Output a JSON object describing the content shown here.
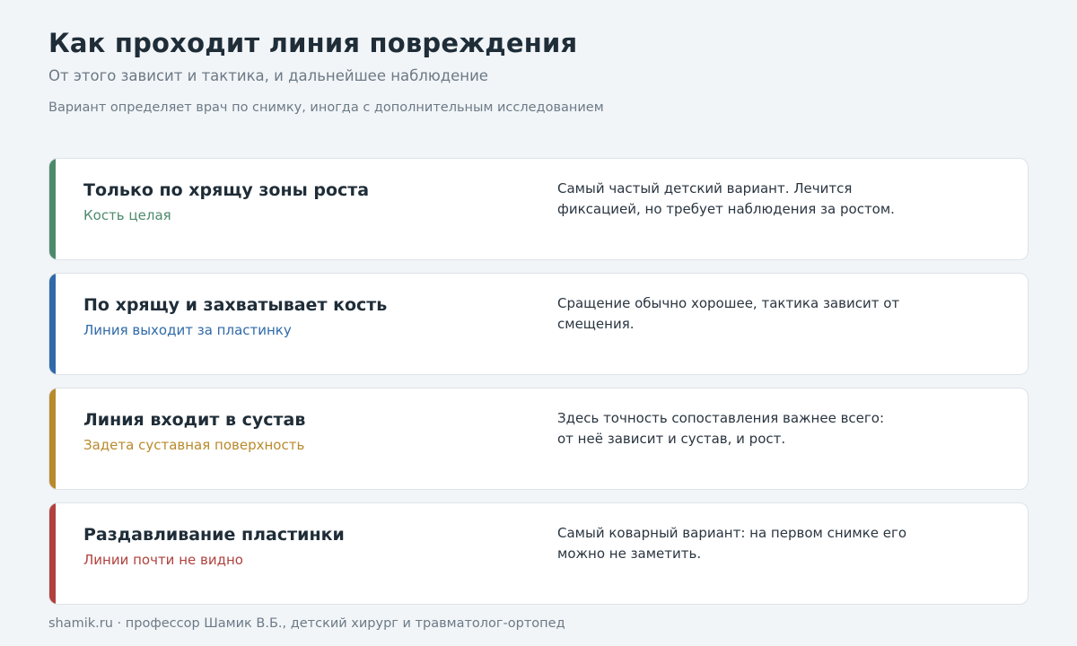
{
  "header": {
    "title": "Как проходит линия повреждения",
    "subtitle": "От этого зависит и тактика, и дальнейшее наблюдение",
    "note": "Вариант определяет врач по снимку, иногда с дополнительным исследованием"
  },
  "cards": [
    {
      "title": "Только по хрящу зоны роста",
      "tag": "Кость целая",
      "description": "Самый частый детский вариант. Лечится\nфиксацией, но требует наблюдения за ростом.",
      "accent": "#4d8a6c"
    },
    {
      "title": "По хрящу и захватывает кость",
      "tag": "Линия выходит за пластинку",
      "description": "Сращение обычно хорошее, тактика зависит от\nсмещения.",
      "accent": "#2f6aa8"
    },
    {
      "title": "Линия входит в сустав",
      "tag": "Задета суставная поверхность",
      "description": "Здесь точность сопоставления важнее всего:\nот неё зависит и сустав, и рост.",
      "accent": "#b88a2c"
    },
    {
      "title": "Раздавливание пластинки",
      "tag": "Линии почти не видно",
      "description": "Самый коварный вариант: на первом снимке его\nможно не заметить.",
      "accent": "#b0413e"
    }
  ],
  "footer": {
    "text": "shamik.ru · профессор Шамик В.Б., детский хирург и травматолог-ортопед"
  }
}
